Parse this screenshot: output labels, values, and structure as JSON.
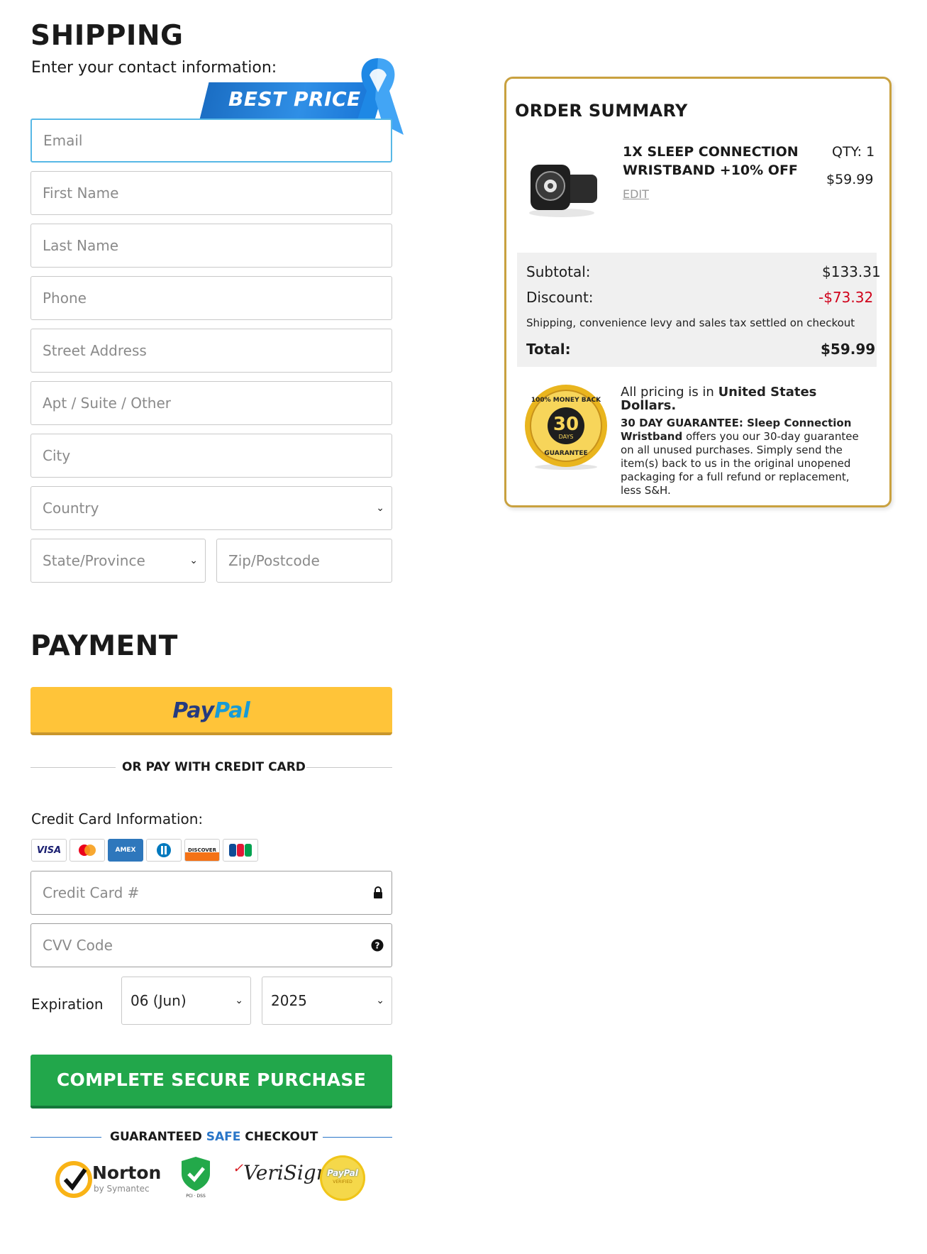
{
  "shipping": {
    "title": "SHIPPING",
    "subtitle": "Enter your contact information:",
    "badge": "BEST PRICE",
    "fields": {
      "email": "Email",
      "first_name": "First Name",
      "last_name": "Last Name",
      "phone": "Phone",
      "street": "Street Address",
      "apt": "Apt / Suite / Other",
      "city": "City",
      "country": "Country",
      "state": "State/Province",
      "zip": "Zip/Postcode"
    }
  },
  "payment": {
    "title": "PAYMENT",
    "paypal_a": "Pay",
    "paypal_b": "Pal",
    "or_text": "OR PAY WITH CREDIT CARD",
    "cc_label": "Credit Card Information:",
    "cards": [
      "VISA",
      "MC",
      "AMEX",
      "DC",
      "DISCOVER",
      "JCB"
    ],
    "cc_placeholder": "Credit Card #",
    "cvv_placeholder": "CVV Code",
    "expiration_label": "Expiration",
    "exp_month": "06 (Jun)",
    "exp_year": "2025",
    "buy_button": "COMPLETE SECURE PURCHASE",
    "safe_a": "GUARANTEED ",
    "safe_b": "SAFE",
    "safe_c": " CHECKOUT",
    "trust": {
      "norton": "Norton",
      "norton_sub": "by Symantec",
      "pci": "PCI · DSS",
      "verisign": "VeriSign",
      "paypal_verified": "PayPal",
      "paypal_verified_sub": "VERIFIED"
    }
  },
  "summary": {
    "title": "ORDER SUMMARY",
    "product_name": "1X SLEEP CONNECTION WRISTBAND +10% OFF",
    "edit": "EDIT",
    "qty": "QTY: 1",
    "price": "$59.99",
    "subtotal_label": "Subtotal:",
    "subtotal": "$133.31",
    "discount_label": "Discount:",
    "discount": "-$73.32",
    "note": "Shipping, convenience levy and sales tax settled on checkout",
    "total_label": "Total:",
    "total": "$59.99",
    "pricing_a": "All pricing is in ",
    "pricing_b": "United States Dollars.",
    "g_bold1": "30 DAY GUARANTEE: Sleep Connection Wristband",
    "g_rest": " offers you our 30-day guarantee on all unused purchases. Simply send the item(s) back to us in the original unopened packaging for a full refund or replacement, less S&H.",
    "seal_num": "30",
    "seal_days": "DAYS",
    "seal_top": "100% MONEY BACK",
    "seal_bottom": "GUARANTEE"
  }
}
